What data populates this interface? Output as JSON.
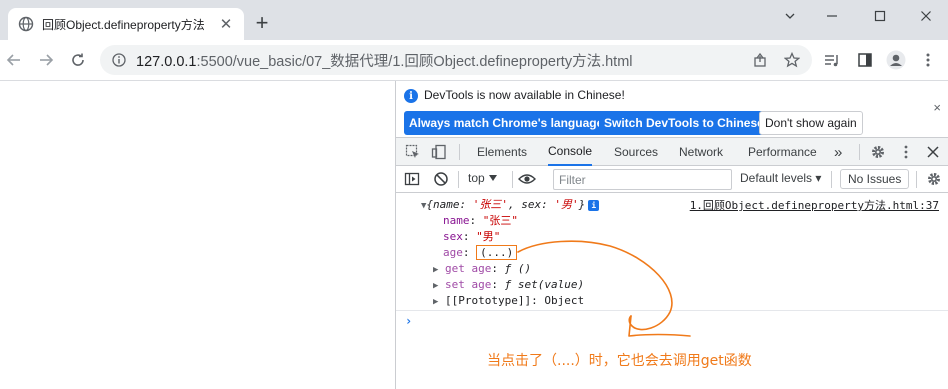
{
  "tab": {
    "title": "回顾Object.defineproperty方法",
    "close": "✕",
    "new_tab": "+"
  },
  "window": {
    "minimize": "minimize",
    "maximize": "maximize",
    "close": "close"
  },
  "address": {
    "host": "127.0.0.1",
    "rest": ":5500/vue_basic/07_数据代理/1.回顾Object.defineproperty方法.html"
  },
  "devtools": {
    "infobar": {
      "message": "DevTools is now available in Chinese!",
      "btn_match": "Always match Chrome's language",
      "btn_switch": "Switch DevTools to Chinese",
      "btn_dont": "Don't show again",
      "close": "×"
    },
    "tabs": [
      {
        "label": "Elements"
      },
      {
        "label": "Console"
      },
      {
        "label": "Sources"
      },
      {
        "label": "Network"
      },
      {
        "label": "Performance"
      }
    ],
    "more_tabs": "»",
    "console_toolbar": {
      "context": "top",
      "filter_placeholder": "Filter",
      "levels": "Default levels ▾",
      "issues": "No Issues"
    },
    "console": {
      "source": "1.回顾Object.defineproperty方法.html:37",
      "summary_pre": "{name: ",
      "summary_name_val": "'张三'",
      "summary_mid": ", sex: ",
      "summary_sex_val": "'男'",
      "summary_post": "}",
      "info_badge": "i",
      "name_key": "name",
      "name_val": "\"张三\"",
      "sex_key": "sex",
      "sex_val": "\"男\"",
      "age_key": "age",
      "age_val": "(...)",
      "get_key": "get age",
      "get_val": "ƒ ()",
      "set_key": "set age",
      "set_val": "ƒ set(value)",
      "proto_key": "[[Prototype]]",
      "proto_val": "Object",
      "prompt": "›"
    }
  },
  "annotation": {
    "text": "当点击了（....）时，它也会去调用get函数",
    "color": "#f07a1a"
  }
}
